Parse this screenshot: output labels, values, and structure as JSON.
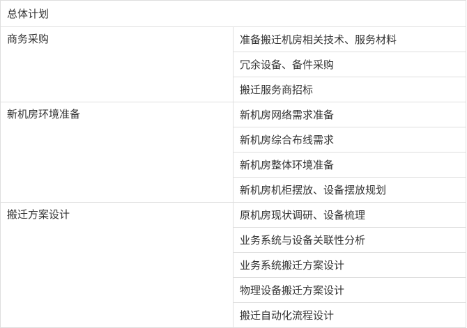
{
  "table": {
    "header": "总体计划",
    "groups": [
      {
        "category": "商务采购",
        "tasks": [
          "准备搬迁机房相关技术、服务材料",
          "冗余设备、备件采购",
          "搬迁服务商招标"
        ]
      },
      {
        "category": "新机房环境准备",
        "tasks": [
          "新机房网络需求准备",
          "新机房综合布线需求",
          "新机房整体环境准备",
          "新机房机柜摆放、设备摆放规划"
        ]
      },
      {
        "category": "搬迁方案设计",
        "tasks": [
          "原机房现状调研、设备梳理",
          "业务系统与设备关联性分析",
          "业务系统搬迁方案设计",
          "物理设备搬迁方案设计",
          "搬迁自动化流程设计"
        ]
      }
    ]
  }
}
